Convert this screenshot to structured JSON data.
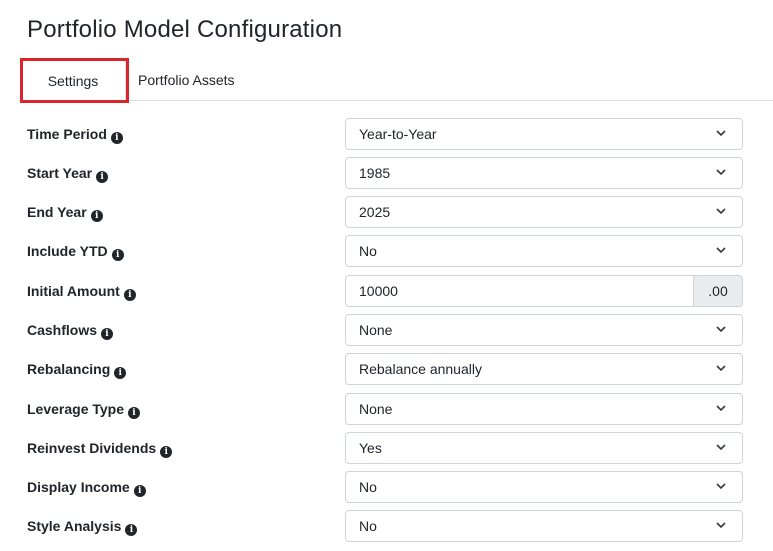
{
  "page": {
    "title": "Portfolio Model Configuration"
  },
  "tabs": [
    {
      "label": "Settings",
      "active": true
    },
    {
      "label": "Portfolio Assets",
      "active": false
    }
  ],
  "form": {
    "time_period": {
      "label": "Time Period",
      "value": "Year-to-Year"
    },
    "start_year": {
      "label": "Start Year",
      "value": "1985"
    },
    "end_year": {
      "label": "End Year",
      "value": "2025"
    },
    "include_ytd": {
      "label": "Include YTD",
      "value": "No"
    },
    "initial_amount": {
      "label": "Initial Amount",
      "value": "10000",
      "addon": ".00"
    },
    "cashflows": {
      "label": "Cashflows",
      "value": "None"
    },
    "rebalancing": {
      "label": "Rebalancing",
      "value": "Rebalance annually"
    },
    "leverage_type": {
      "label": "Leverage Type",
      "value": "None"
    },
    "reinvest_dividends": {
      "label": "Reinvest Dividends",
      "value": "Yes"
    },
    "display_income": {
      "label": "Display Income",
      "value": "No"
    },
    "style_analysis": {
      "label": "Style Analysis",
      "value": "No"
    }
  },
  "icons": {
    "info": "info-circle-icon",
    "dropdown": "chevron-down-icon"
  },
  "colors": {
    "highlight": "#d9262a",
    "text": "#212529",
    "border": "#ced4da",
    "addon_bg": "#e9ecef"
  }
}
